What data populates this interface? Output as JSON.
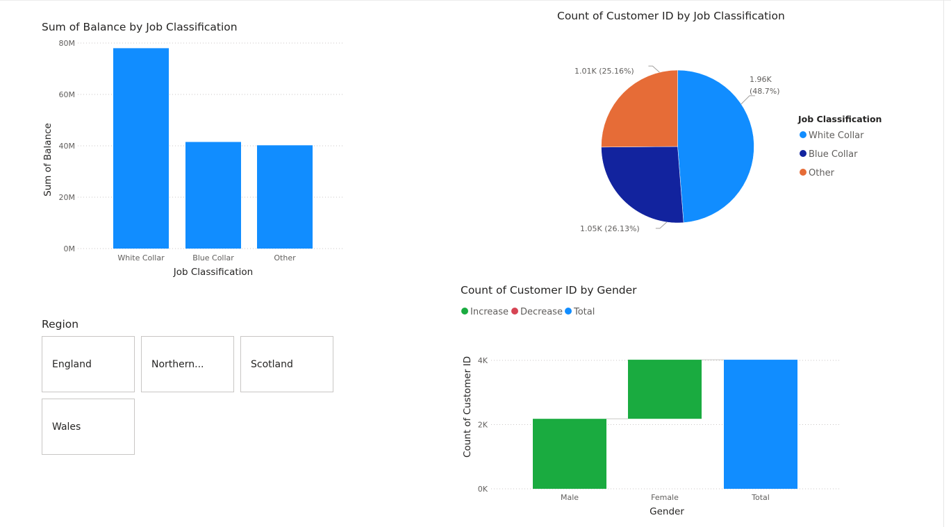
{
  "colors": {
    "white_collar": "#118DFF",
    "blue_collar": "#12239E",
    "other": "#E66C37",
    "increase": "#1AAB40",
    "decrease": "#D64554",
    "total": "#118DFF",
    "gridline": "#c8c6c4",
    "connector": "#c8c6c4"
  },
  "balance_chart": {
    "title": "Sum of Balance by Job Classification",
    "chart_data": {
      "type": "bar",
      "categories": [
        "White Collar",
        "Blue Collar",
        "Other"
      ],
      "values": [
        78000000,
        41500000,
        40200000
      ],
      "xlabel": "Job Classification",
      "ylabel": "Sum of Balance",
      "ylim": [
        0,
        80000000
      ],
      "yticks": [
        "0M",
        "20M",
        "40M",
        "60M",
        "80M"
      ],
      "grid": true
    }
  },
  "pie_chart": {
    "title": "Count of Customer ID by Job Classification",
    "legend_title": "Job Classification",
    "legend_position": "right",
    "chart_data": {
      "type": "pie",
      "slices": [
        {
          "name": "White Collar",
          "value": 1960,
          "percent": 48.7,
          "label_value": "1.96K",
          "label_percent": "(48.7%)"
        },
        {
          "name": "Blue Collar",
          "value": 1050,
          "percent": 26.13,
          "label": "1.05K (26.13%)"
        },
        {
          "name": "Other",
          "value": 1010,
          "percent": 25.16,
          "label": "1.01K (25.16%)"
        }
      ]
    }
  },
  "gender_chart": {
    "title": "Count of Customer ID by Gender",
    "legend": [
      "Increase",
      "Decrease",
      "Total"
    ],
    "chart_data": {
      "type": "waterfall",
      "categories": [
        "Male",
        "Female",
        "Total"
      ],
      "values": [
        2180,
        1840,
        4020
      ],
      "kinds": [
        "Increase",
        "Increase",
        "Total"
      ],
      "xlabel": "Gender",
      "ylabel": "Count of Customer ID",
      "ylim": [
        0,
        4000
      ],
      "yticks": [
        "0K",
        "2K",
        "4K"
      ],
      "grid": true
    }
  },
  "region_slicer": {
    "title": "Region",
    "items": [
      "England",
      "Northern...",
      "Scotland",
      "Wales"
    ]
  }
}
